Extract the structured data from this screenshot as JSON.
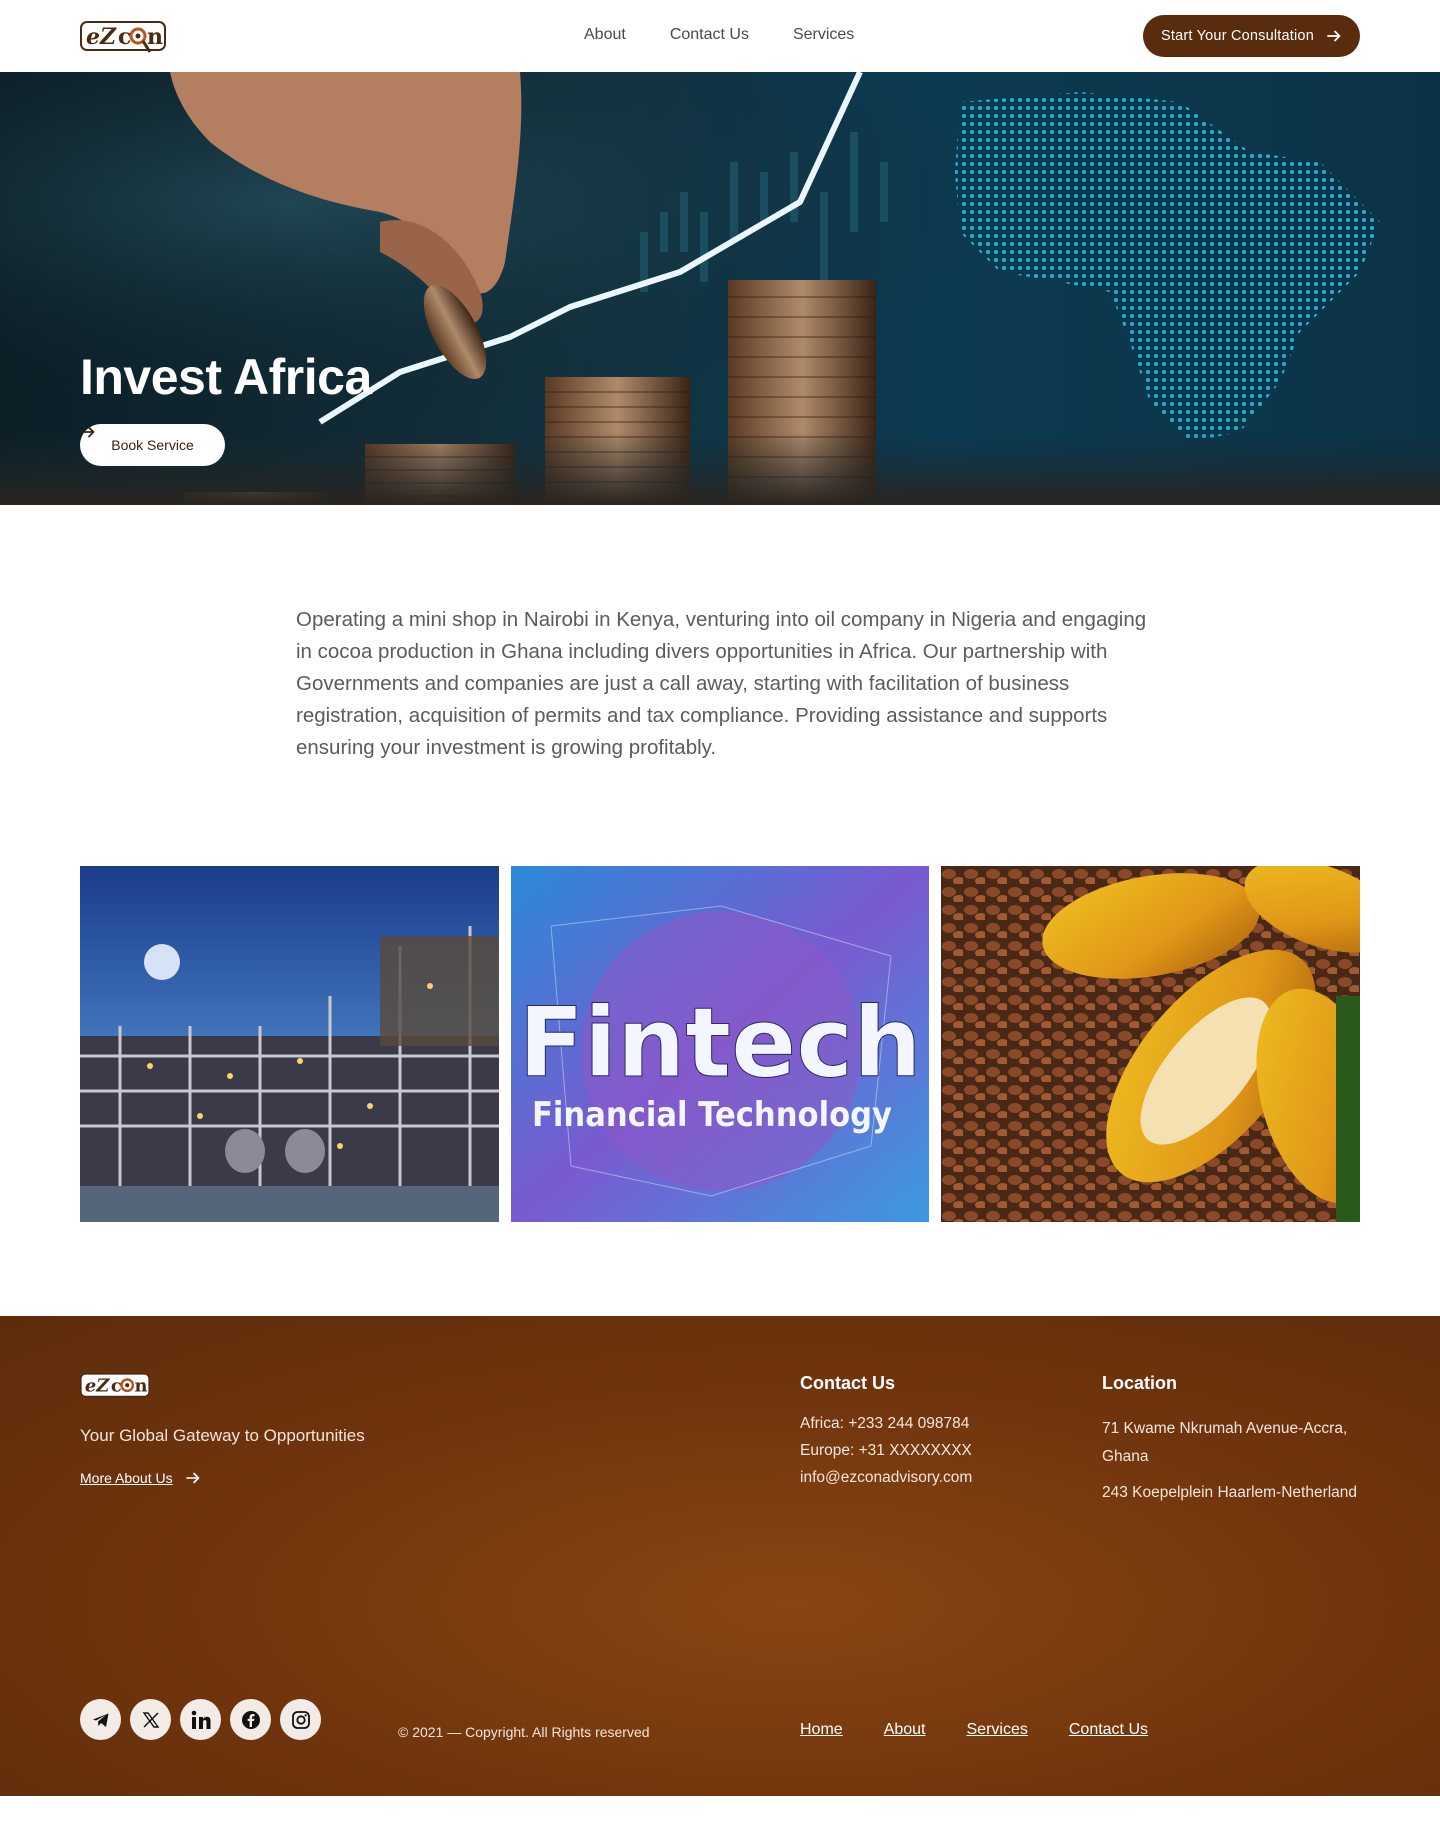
{
  "brand": {
    "logo_text": "ezcon",
    "logo_icon": "magnifier-logo-icon"
  },
  "header": {
    "nav": [
      {
        "label": "About"
      },
      {
        "label": "Contact Us"
      },
      {
        "label": "Services"
      }
    ],
    "cta_label": "Start Your Consultation",
    "cta_icon": "arrow-right-icon"
  },
  "hero": {
    "title": "Invest Africa",
    "button_label": "Book Service",
    "button_icon": "arrow-right-icon"
  },
  "intro": {
    "text": "Operating a mini shop in Nairobi in Kenya, venturing into oil company in Nigeria and engaging in cocoa production in Ghana including divers opportunities in Africa. Our partnership with Governments and companies are just a call away, starting with facilitation of business registration, acquisition of permits and tax compliance. Providing assistance and supports ensuring your investment is growing profitably."
  },
  "gallery": {
    "fintech_title": "Fintech",
    "fintech_subtitle": "Financial Technology"
  },
  "footer": {
    "tagline": "Your Global Gateway to  Opportunities",
    "more_about": "More About Us",
    "contact": {
      "heading": "Contact Us",
      "africa": "Africa: +233 244 098784",
      "europe": "Europe: +31 XXXXXXXX",
      "email": "info@ezconadvisory.com"
    },
    "location": {
      "heading": "Location",
      "address1": "71 Kwame Nkrumah Avenue-Accra, Ghana",
      "address2": "243 Koepelplein Haarlem-Netherland"
    },
    "social_icons": [
      "telegram-icon",
      "x-icon",
      "linkedin-icon",
      "facebook-icon",
      "instagram-icon"
    ],
    "copyright": "© 2021 — Copyright. All Rights reserved",
    "nav": [
      {
        "label": "Home"
      },
      {
        "label": "About"
      },
      {
        "label": "Services"
      },
      {
        "label": "Contact Us"
      }
    ]
  },
  "colors": {
    "brand_brown": "#5a2c0e",
    "footer_brown": "#6f340d",
    "hero_teal": "#0c3a52"
  }
}
